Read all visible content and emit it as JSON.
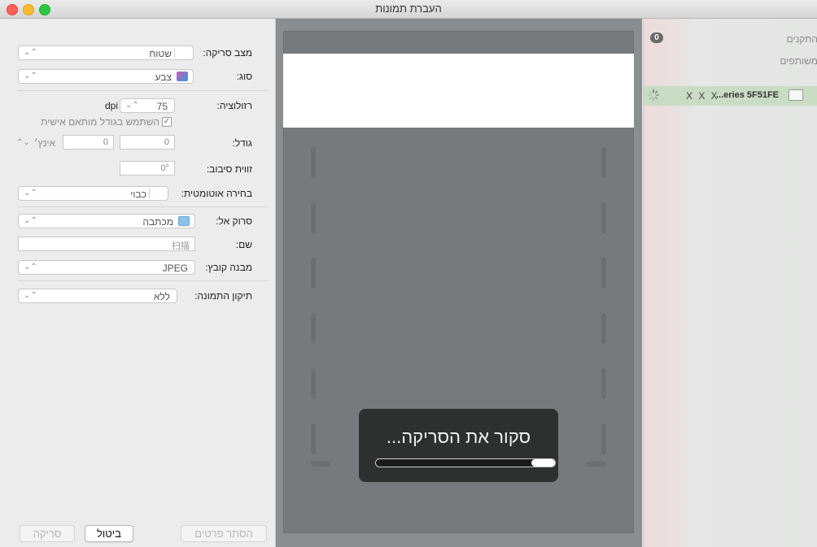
{
  "window": {
    "title": "העברת תמונות"
  },
  "settings": {
    "scan_mode": {
      "label": "מצב סריקה:",
      "value": "שטוח"
    },
    "kind": {
      "label": "סוג:",
      "value": "צבע"
    },
    "resolution": {
      "label": "רזולוציה:",
      "value": "75",
      "unit": "dpi"
    },
    "custom_size": {
      "label": "השתמש בגודל מותאם אישית",
      "checked": true,
      "mark": "✓"
    },
    "size": {
      "label": "גודל:",
      "width": "0",
      "height": "0",
      "unit": "אינץ׳"
    },
    "rotation": {
      "label": "זווית סיבוב:",
      "value": "0°"
    },
    "auto_select": {
      "label": "בחירה אוטומטית:",
      "value": "כבוי"
    },
    "scan_to": {
      "label": "סרוק אל:",
      "value": "מכתבה"
    },
    "name": {
      "label": "שם:",
      "value": "扫描"
    },
    "format": {
      "label": "מבנה קובץ:",
      "value": "JPEG"
    },
    "correction": {
      "label": "תיקון התמונה:",
      "value": "ללא"
    },
    "buttons": {
      "hide_details": "הסתר פרטים",
      "cancel": "ביטול",
      "scan": "סריקה"
    },
    "arrows_glyph": "⌃⌄"
  },
  "preview": {
    "hud_text": "סקור את הסריקה...",
    "progress": 0.13
  },
  "devices": {
    "section_devices": "התקנים",
    "badge_count": "0",
    "section_shared": "משותפים",
    "device_name": "...eries 5F51FE",
    "device_extra": "X X X"
  },
  "colors": {
    "chip_color_a": "#c85ab8",
    "chip_color_b": "#3aa0d8",
    "folder_color": "#8fc2ea"
  }
}
